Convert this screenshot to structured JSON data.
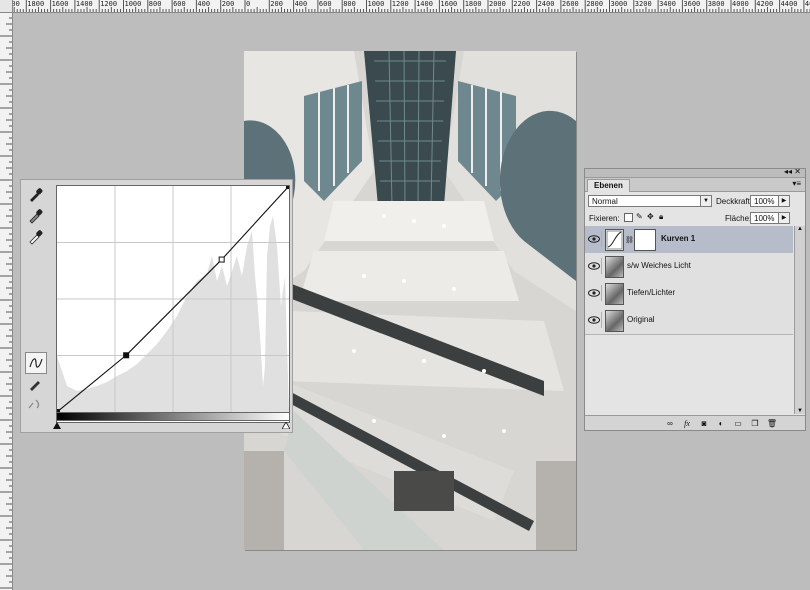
{
  "ruler": {
    "top_labels": [
      "2000",
      "1800",
      "1600",
      "1400",
      "1200",
      "1000",
      "800",
      "600",
      "400",
      "200",
      "0",
      "200",
      "400",
      "600",
      "800",
      "1000",
      "1200",
      "1400",
      "1600",
      "1800",
      "2000",
      "2200",
      "2400",
      "2600",
      "2800",
      "3000",
      "3200",
      "3400",
      "3600",
      "3800",
      "4000",
      "4200",
      "4400",
      "4600"
    ]
  },
  "curves": {
    "points": [
      [
        0,
        0
      ],
      [
        76,
        64
      ],
      [
        181,
        172
      ],
      [
        255,
        255
      ]
    ]
  },
  "layers_panel": {
    "tab_label": "Ebenen",
    "blend_mode": "Normal",
    "opacity_label": "Deckkraft:",
    "opacity_value": "100%",
    "lock_label": "Fixieren:",
    "fill_label": "Fläche:",
    "fill_value": "100%",
    "layers": [
      {
        "name": "Kurven 1",
        "active": true,
        "icon": "curves-adjustment-icon"
      },
      {
        "name": "s/w Weiches Licht",
        "active": false,
        "icon": "image-thumbnail"
      },
      {
        "name": "Tiefen/Lichter",
        "active": false,
        "icon": "image-thumbnail"
      },
      {
        "name": "Original",
        "active": false,
        "icon": "image-thumbnail"
      }
    ]
  },
  "colors": {
    "workspace": "#bdbdbd",
    "active_layer": "#b7bccb"
  }
}
